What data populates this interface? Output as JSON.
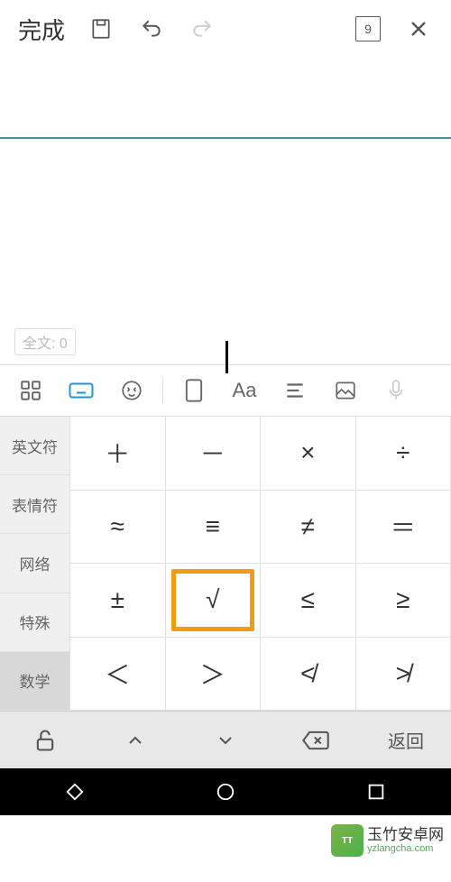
{
  "toolbar": {
    "done_label": "完成",
    "page_number": "9"
  },
  "editor": {
    "word_count_label": "全文: 0"
  },
  "ime": {
    "toolbar_items": [
      "apps",
      "keyboard",
      "emoji",
      "fullscreen",
      "font",
      "align",
      "image",
      "mic"
    ],
    "categories": [
      {
        "label": "英文符"
      },
      {
        "label": "表情符"
      },
      {
        "label": "网络"
      },
      {
        "label": "特殊"
      },
      {
        "label": "数学"
      }
    ],
    "selected_category_index": 4,
    "symbols": [
      {
        "char": "＋"
      },
      {
        "char": "－"
      },
      {
        "char": "×"
      },
      {
        "char": "÷"
      },
      {
        "char": "≈"
      },
      {
        "char": "≡"
      },
      {
        "char": "≠"
      },
      {
        "char": "＝"
      },
      {
        "char": "±"
      },
      {
        "char": "√",
        "highlighted": true
      },
      {
        "char": "≤"
      },
      {
        "char": "≥"
      },
      {
        "char": "＜"
      },
      {
        "char": "＞"
      },
      {
        "char": "≮"
      },
      {
        "char": "≯"
      }
    ],
    "bottom": {
      "return_label": "返回"
    }
  },
  "watermark": {
    "logo_text": "TT",
    "title": "玉竹安卓网",
    "url": "yzlangcha.com"
  }
}
